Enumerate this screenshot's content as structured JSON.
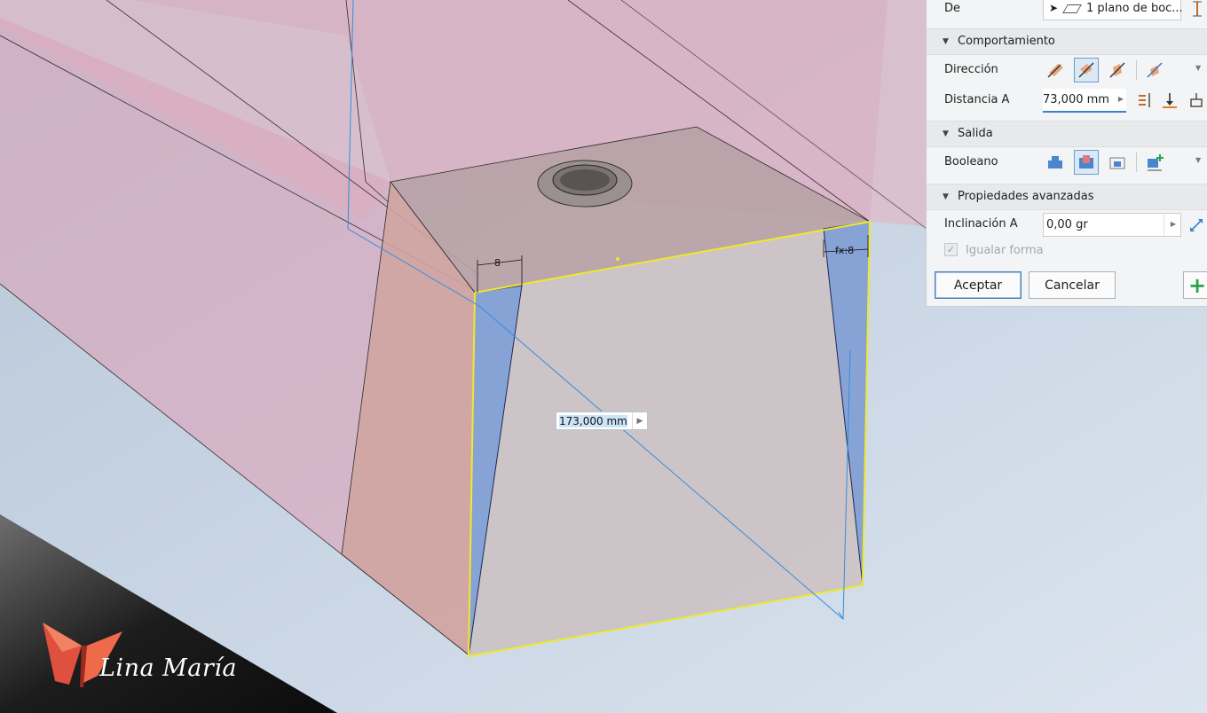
{
  "viewport": {
    "dimension_value": "173,000 mm",
    "dim_left_label": "8",
    "dim_right_label": "fx:8"
  },
  "panel": {
    "de": {
      "label": "De",
      "value": "1 plano de boc..."
    },
    "comportamiento": {
      "title": "Comportamiento",
      "direccion_label": "Dirección",
      "distancia_label": "Distancia A",
      "distancia_value": "73,000 mm"
    },
    "salida": {
      "title": "Salida",
      "booleano_label": "Booleano"
    },
    "avanzadas": {
      "title": "Propiedades avanzadas",
      "inclinacion_label": "Inclinación A",
      "inclinacion_value": "0,00 gr",
      "igualar_label": "Igualar forma",
      "igualar_checked": true
    },
    "buttons": {
      "accept": "Aceptar",
      "cancel": "Cancelar"
    }
  },
  "watermark": {
    "text": "Lina María"
  },
  "colors": {
    "background": "#c6d3e2",
    "body_pink": "#dcb3c3",
    "selection_yellow": "#f0e82a",
    "sketch_blue": "#2f8fe0",
    "active_button": "#dbe8f6",
    "accent_green": "#2aa24a"
  }
}
